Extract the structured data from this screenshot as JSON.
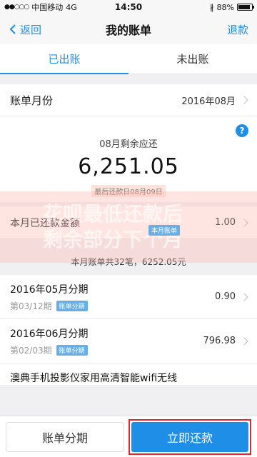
{
  "status_bar": {
    "carrier": "中国移动",
    "network": "4G",
    "time": "14:50",
    "battery": "88%",
    "battery_level": 0.88
  },
  "nav": {
    "back_label": "返回",
    "title": "我的账单",
    "right_label": "退款"
  },
  "tabs": [
    {
      "label": "已出账",
      "active": true
    },
    {
      "label": "未出账",
      "active": false
    }
  ],
  "bill_month": {
    "label": "账单月份",
    "value": "2016年08月"
  },
  "summary": {
    "label": "08月剩余应还",
    "amount": "6,251.05",
    "due_text": "最后还款日08月09日"
  },
  "overlay": {
    "line1": "花呗最低还款后",
    "line2": "剩余部分下个月",
    "badge": "本月账单"
  },
  "repaid": {
    "label": "本月已还款金额",
    "value": "1.00"
  },
  "bills_count": "本月账单共32笔，6252.05元",
  "bills": [
    {
      "title": "2016年05月分期",
      "period": "第03/12期",
      "tag": "账单分期",
      "amount": "0.90"
    },
    {
      "title": "2016年06月分期",
      "period": "第02/03期",
      "tag": "账单分期",
      "amount": "796.98"
    }
  ],
  "partial_bill": "澳典手机投影仪家用高清智能wifi无线",
  "bottom": {
    "installment_label": "账单分期",
    "pay_label": "立即还款"
  },
  "colors": {
    "accent": "#1f8ee6",
    "highlight_border": "#e0282e"
  }
}
